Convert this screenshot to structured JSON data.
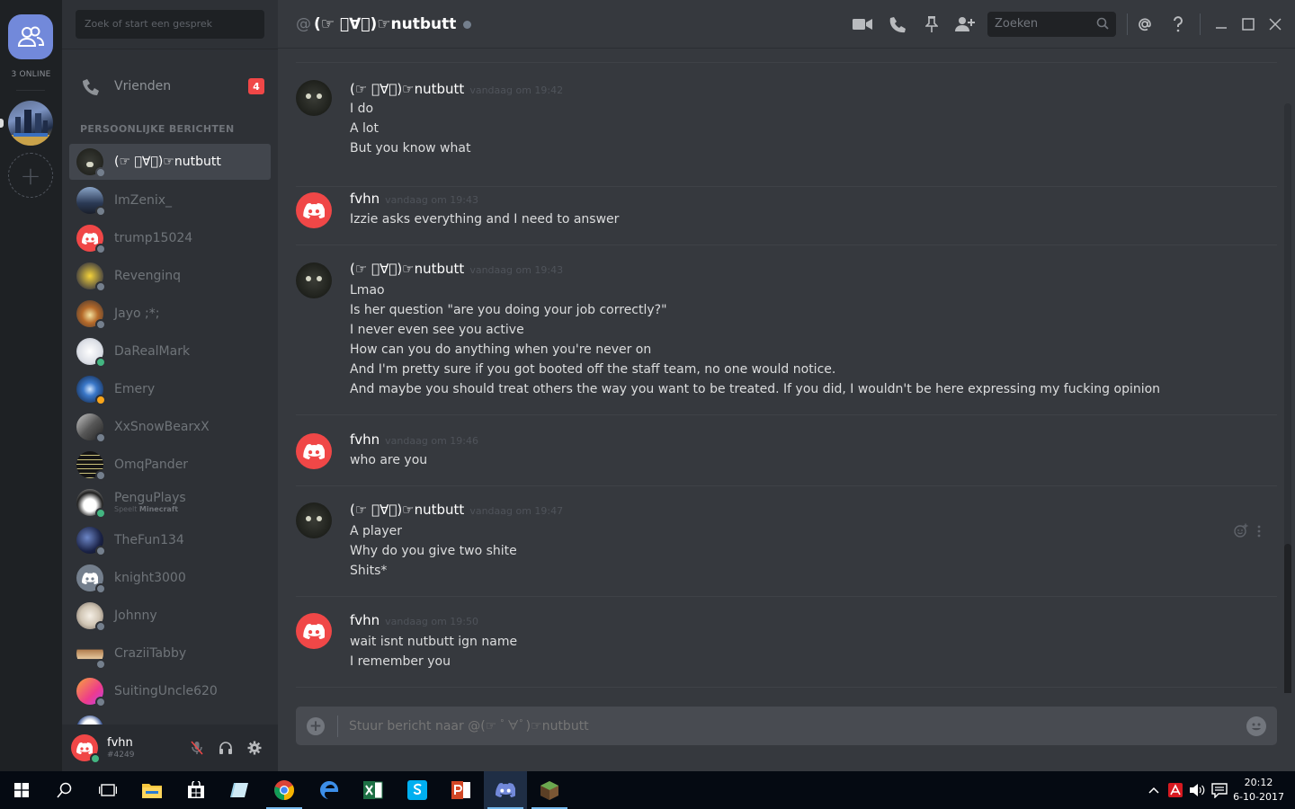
{
  "rail": {
    "online_label": "3 ONLINE"
  },
  "sidebar": {
    "search_placeholder": "Zoek of start een gesprek",
    "friends_label": "Vrienden",
    "friends_badge": "4",
    "section_title": "PERSOONLIJKE BERICHTEN",
    "dms": [
      {
        "name": "(☞ ﾟ∀ﾟ)☞nutbutt",
        "active": true
      },
      {
        "name": "ImZenix_"
      },
      {
        "name": "trump15024"
      },
      {
        "name": "Revenginq"
      },
      {
        "name": "Jayo ;*;"
      },
      {
        "name": "DaRealMark"
      },
      {
        "name": "Emery"
      },
      {
        "name": "XxSnowBearxX"
      },
      {
        "name": "OmqPander"
      },
      {
        "name": "PenguPlays",
        "sub_prefix": "Speelt ",
        "sub_game": "Minecraft"
      },
      {
        "name": "TheFun134"
      },
      {
        "name": "knight3000"
      },
      {
        "name": "Johnny"
      },
      {
        "name": "CraziiTabby"
      },
      {
        "name": "SuitingUncle620"
      }
    ]
  },
  "user": {
    "name": "fvhn",
    "tag": "#4249"
  },
  "header": {
    "at": "@",
    "title": "(☞ ﾟ∀ﾟ)☞nutbutt",
    "search_placeholder": "Zoeken"
  },
  "messages": [
    {
      "user": "(☞ ﾟ∀ﾟ)☞nutbutt",
      "avatar": "cat",
      "time": "vandaag om 19:42",
      "lines": [
        "I do",
        "A lot",
        "But you know what"
      ]
    },
    {
      "user": "fvhn",
      "avatar": "discord",
      "time": "vandaag om 19:43",
      "lines": [
        "Izzie asks everything and I need to answer"
      ]
    },
    {
      "user": "(☞ ﾟ∀ﾟ)☞nutbutt",
      "avatar": "cat",
      "time": "vandaag om 19:43",
      "lines": [
        "Lmao",
        "Is her question \"are you doing your job correctly?\"",
        "I never even see you active",
        "How can you do anything when you're never on",
        "And I'm pretty sure if you got booted off the staff team, no one would notice.",
        "And maybe you should treat others the way you want to be treated. If you did, I wouldn't be here expressing my fucking opinion"
      ]
    },
    {
      "user": "fvhn",
      "avatar": "discord",
      "time": "vandaag om 19:46",
      "lines": [
        "who are you"
      ]
    },
    {
      "user": "(☞ ﾟ∀ﾟ)☞nutbutt",
      "avatar": "cat",
      "time": "vandaag om 19:47",
      "lines": [
        "A player",
        "Why do you give two shite",
        "Shits*"
      ]
    },
    {
      "user": "fvhn",
      "avatar": "discord",
      "time": "vandaag om 19:50",
      "lines": [
        "wait isnt nutbutt ign name",
        "I remember you"
      ]
    }
  ],
  "composer": {
    "placeholder": "Stuur bericht naar @(☞ ﾟ∀ﾟ)☞nutbutt"
  },
  "taskbar": {
    "time": "20:12",
    "date": "6-10-2017"
  },
  "colors": {
    "accent": "#7289da",
    "online": "#43b581",
    "offline": "#747f8d",
    "badge": "#f04747"
  }
}
